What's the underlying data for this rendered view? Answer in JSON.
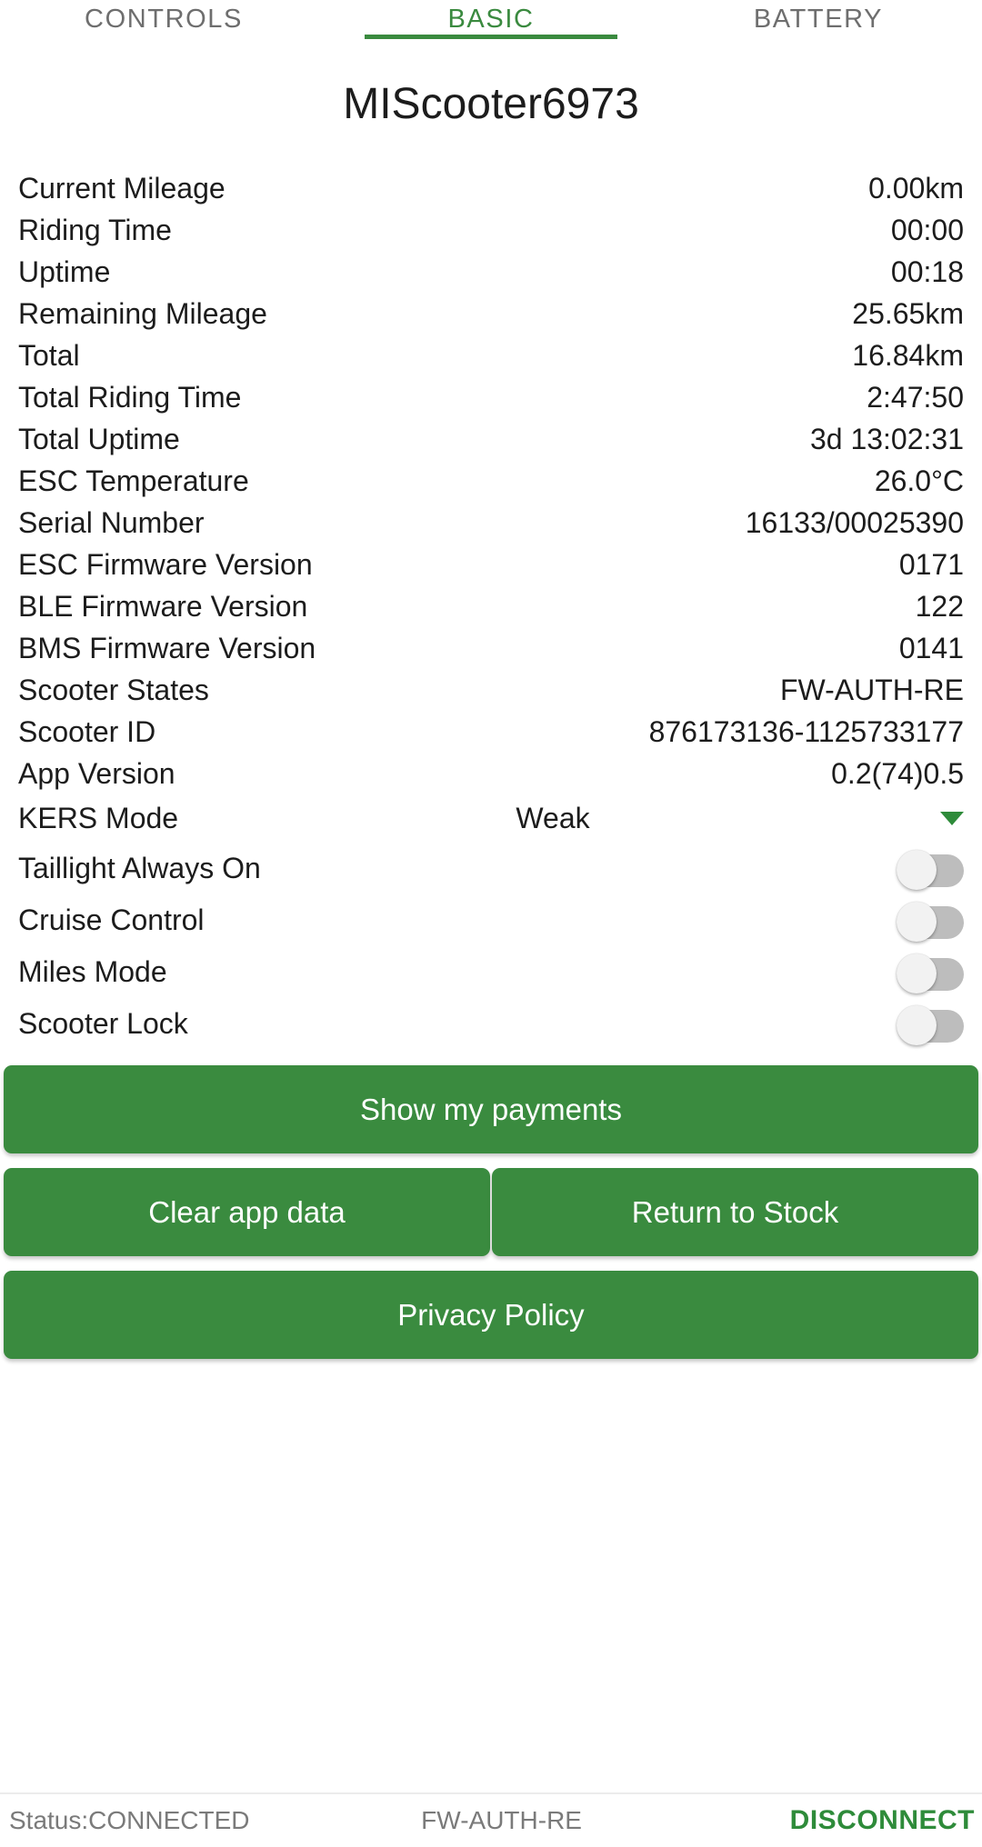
{
  "theme": {
    "accent_green": "#3a8a3f",
    "button_green": "#3a8b3f",
    "inactive_tab_grey": "#6e6e6e",
    "text_dark": "#1c1c1c",
    "status_grey": "#7a7a7a",
    "toggle_track_grey": "#bdbdbd",
    "toggle_knob_white": "#f2f2f2"
  },
  "tabs": [
    {
      "label": "CONTROLS",
      "active": false
    },
    {
      "label": "BASIC",
      "active": true
    },
    {
      "label": "BATTERY",
      "active": false
    }
  ],
  "device": {
    "title": "MIScooter6973"
  },
  "info_rows": [
    {
      "label": "Current Mileage",
      "value": "0.00km"
    },
    {
      "label": "Riding Time",
      "value": "00:00"
    },
    {
      "label": "Uptime",
      "value": "00:18"
    },
    {
      "label": "Remaining Mileage",
      "value": "25.65km"
    },
    {
      "label": "Total",
      "value": "16.84km"
    },
    {
      "label": "Total Riding Time",
      "value": "2:47:50"
    },
    {
      "label": "Total Uptime",
      "value": "3d 13:02:31"
    },
    {
      "label": "ESC Temperature",
      "value": "26.0°C"
    },
    {
      "label": "Serial Number",
      "value": "16133/00025390"
    },
    {
      "label": "ESC Firmware Version",
      "value": "0171"
    },
    {
      "label": "BLE Firmware Version",
      "value": "122"
    },
    {
      "label": "BMS Firmware Version",
      "value": "0141"
    },
    {
      "label": "Scooter States",
      "value": "FW-AUTH-RE"
    },
    {
      "label": "Scooter ID",
      "value": "876173136-1125733177"
    },
    {
      "label": "App Version",
      "value": "0.2(74)0.5"
    }
  ],
  "kers": {
    "label": "KERS Mode",
    "value": "Weak",
    "caret_icon": "chevron-down-icon"
  },
  "toggles": [
    {
      "label": "Taillight Always On",
      "on": false
    },
    {
      "label": "Cruise Control",
      "on": false
    },
    {
      "label": "Miles Mode",
      "on": false
    },
    {
      "label": "Scooter Lock",
      "on": false
    }
  ],
  "buttons": {
    "show_payments": "Show my payments",
    "clear_app_data": "Clear app data",
    "return_to_stock": "Return to Stock",
    "privacy_policy": "Privacy Policy"
  },
  "statusbar": {
    "status": "Status:CONNECTED",
    "state": "FW-AUTH-RE",
    "disconnect": "DISCONNECT"
  }
}
